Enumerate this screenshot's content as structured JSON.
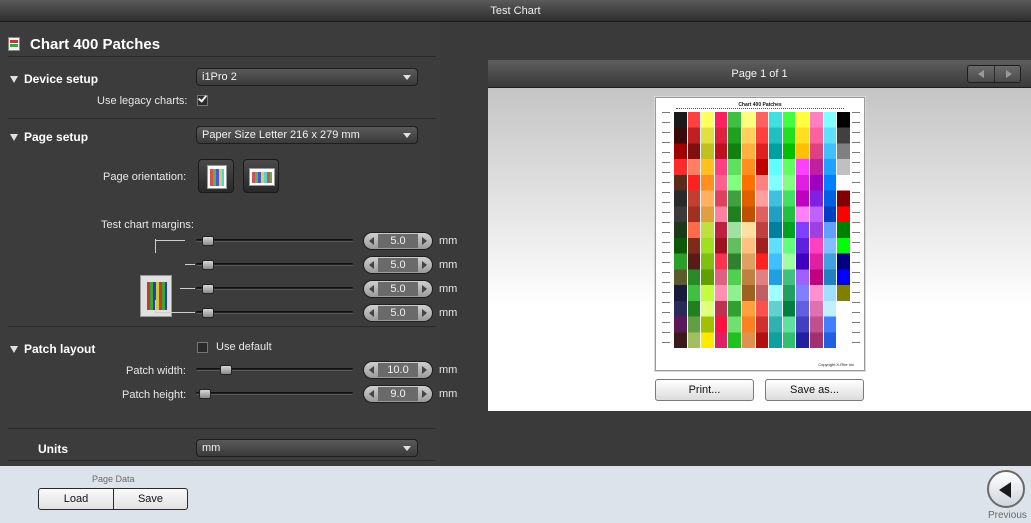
{
  "window": {
    "title": "Test Chart"
  },
  "header": {
    "title": "Chart 400 Patches",
    "icon": "chart-document-icon"
  },
  "device_setup": {
    "title": "Device setup",
    "device_value": "i1Pro 2",
    "legacy_label": "Use legacy charts:",
    "legacy_checked": true
  },
  "page_setup": {
    "title": "Page setup",
    "paper_value": "Paper Size Letter  216 x 279 mm",
    "orientation_label": "Page orientation:",
    "margins_label": "Test chart margins:",
    "margins": [
      {
        "value": "5.0",
        "unit": "mm",
        "slider_fraction": 0.05
      },
      {
        "value": "5.0",
        "unit": "mm",
        "slider_fraction": 0.05
      },
      {
        "value": "5.0",
        "unit": "mm",
        "slider_fraction": 0.05
      },
      {
        "value": "5.0",
        "unit": "mm",
        "slider_fraction": 0.05
      }
    ]
  },
  "patch_layout": {
    "title": "Patch layout",
    "use_default_label": "Use default",
    "use_default_checked": false,
    "width_label": "Patch width:",
    "width_value": "10.0",
    "width_unit": "mm",
    "height_label": "Patch height:",
    "height_value": "9.0",
    "height_unit": "mm"
  },
  "units": {
    "title": "Units",
    "value": "mm"
  },
  "preview": {
    "page_indicator": "Page 1 of 1",
    "chart_title": "Chart 400 Patches",
    "footer_text": "Copyright X-Rite Inc",
    "print_label": "Print...",
    "save_as_label": "Save as..."
  },
  "bottom": {
    "page_data_label": "Page Data",
    "load_label": "Load",
    "save_label": "Save",
    "previous_label": "Previous"
  },
  "patch_columns": [
    [
      "#1a1a1a",
      "#3a0a0a",
      "#a00000",
      "#ff2a2a",
      "#5a2a1a",
      "#2a2a2a",
      "#3a3a3a",
      "#1a3a1a",
      "#0a5a0a",
      "#2aa02a",
      "#5a5a2a",
      "#1a1a3a",
      "#2a2a5a",
      "#5a1a5a",
      "#3a1a1a"
    ],
    [
      "#ff4040",
      "#c02020",
      "#801010",
      "#ff8060",
      "#ff2020",
      "#c04030",
      "#a03020",
      "#ff6a4a",
      "#802a1a",
      "#5a1a1a",
      "#2a8a2a",
      "#40c040",
      "#208020",
      "#60a040",
      "#a0c060"
    ],
    [
      "#ffff60",
      "#e0e040",
      "#c0c020",
      "#ffc020",
      "#ff9020",
      "#ffb060",
      "#e0a040",
      "#c0e040",
      "#a0e020",
      "#80c010",
      "#60a000",
      "#c0ff40",
      "#e0ff80",
      "#a0c000",
      "#ffea00"
    ],
    [
      "#ff2060",
      "#e02040",
      "#c01020",
      "#ff4080",
      "#ff6090",
      "#e04060",
      "#ff80a0",
      "#c02040",
      "#a01020",
      "#ff3050",
      "#e06080",
      "#ff90b0",
      "#c03050",
      "#ff1040",
      "#e02060"
    ],
    [
      "#40c040",
      "#20a020",
      "#108010",
      "#60e060",
      "#80ff80",
      "#40a040",
      "#208020",
      "#a0e0a0",
      "#60c060",
      "#308030",
      "#50d050",
      "#90f090",
      "#30a030",
      "#70e070",
      "#20c020"
    ],
    [
      "#ffff80",
      "#ffd060",
      "#ffb040",
      "#ff9020",
      "#ff7000",
      "#e06000",
      "#c05000",
      "#ffe0a0",
      "#ffc080",
      "#e0a060",
      "#c08040",
      "#a06020",
      "#ffa040",
      "#ff8020",
      "#e09050"
    ],
    [
      "#ff6060",
      "#ff4040",
      "#e02020",
      "#c00000",
      "#ff8080",
      "#ffa0a0",
      "#e06060",
      "#c04040",
      "#a02020",
      "#ff2020",
      "#e08080",
      "#c06060",
      "#ff5050",
      "#d03030",
      "#b01010"
    ],
    [
      "#40e0e0",
      "#20c0c0",
      "#00a0a0",
      "#60ffff",
      "#80ffff",
      "#40c0e0",
      "#20a0c0",
      "#0080a0",
      "#60e0ff",
      "#40c0ff",
      "#20a0e0",
      "#a0ffff",
      "#60d0d0",
      "#30b0b0",
      "#10a0a0"
    ],
    [
      "#40ff40",
      "#20e020",
      "#00c000",
      "#60ff60",
      "#80ff80",
      "#40e060",
      "#20c040",
      "#00a020",
      "#60ff80",
      "#a0ffa0",
      "#40c080",
      "#20a060",
      "#008040",
      "#60e0a0",
      "#30c070"
    ],
    [
      "#ffff40",
      "#ffe020",
      "#ffc000",
      "#ff40ff",
      "#e020e0",
      "#c000c0",
      "#ff80ff",
      "#8040ff",
      "#6020e0",
      "#4000c0",
      "#a060ff",
      "#8080ff",
      "#6060e0",
      "#4040c0",
      "#2020a0"
    ],
    [
      "#ff80c0",
      "#ff60a0",
      "#e04080",
      "#c020a0",
      "#a000c0",
      "#8020e0",
      "#c060ff",
      "#a040e0",
      "#ff40c0",
      "#e020a0",
      "#c00080",
      "#ff90d0",
      "#e070b0",
      "#c05090",
      "#a03070"
    ],
    [
      "#80ffff",
      "#60e0ff",
      "#40c0ff",
      "#20a0ff",
      "#0080ff",
      "#0060e0",
      "#0040c0",
      "#60a0ff",
      "#80c0ff",
      "#40a0e0",
      "#2080c0",
      "#a0e0ff",
      "#c0f0ff",
      "#4080ff",
      "#2060e0"
    ],
    [
      "#000000",
      "#404040",
      "#808080",
      "#c0c0c0",
      "#ffffff",
      "#800000",
      "#ff0000",
      "#008000",
      "#00ff00",
      "#000080",
      "#0000ff",
      "#808000",
      "#ffffff",
      "#ffffff",
      "#ffffff"
    ]
  ]
}
